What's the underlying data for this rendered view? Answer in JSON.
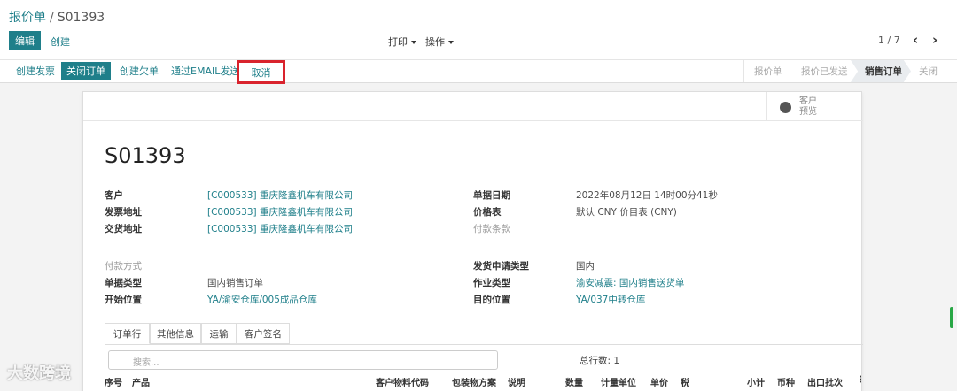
{
  "breadcrumb": {
    "root": "报价单",
    "sep": "/",
    "current": "S01393"
  },
  "toolbar": {
    "edit": "编辑",
    "create": "创建",
    "print": "打印",
    "action": "操作",
    "pager": "1 / 7",
    "prev": "‹",
    "next": "›"
  },
  "actions": {
    "invoice": "创建发票",
    "close_order": "关闭订单",
    "backorder": "创建欠单",
    "email": "通过EMAIL发送",
    "cancel": "取消"
  },
  "stages": [
    "报价单",
    "报价已发送",
    "销售订单",
    "关闭"
  ],
  "preview": {
    "line1": "客户",
    "line2": "预览"
  },
  "doc": {
    "title": "S01393",
    "customer_label": "客户",
    "customer": "[C000533] 重庆隆鑫机车有限公司",
    "invoice_addr_label": "发票地址",
    "invoice_addr": "[C000533] 重庆隆鑫机车有限公司",
    "delivery_addr_label": "交货地址",
    "delivery_addr": "[C000533] 重庆隆鑫机车有限公司",
    "date_label": "单据日期",
    "date": "2022年08月12日 14时00分41秒",
    "pricelist_label": "价格表",
    "pricelist": "默认 CNY 价目表 (CNY)",
    "payterm_label": "付款条款",
    "paymethod_label": "付款方式",
    "doctype_label": "单据类型",
    "doctype": "国内销售订单",
    "start_loc_label": "开始位置",
    "start_loc": "YA/渝安仓库/005成品仓库",
    "ship_req_label": "发货申请类型",
    "ship_req": "国内",
    "op_type_label": "作业类型",
    "op_type": "渝安减震: 国内销售送货单",
    "dest_loc_label": "目的位置",
    "dest_loc": "YA/037中转仓库"
  },
  "tabs": [
    "订单行",
    "其他信息",
    "运输",
    "客户签名"
  ],
  "lines": {
    "search_placeholder": "搜索...",
    "total": "总行数: 1",
    "headers": [
      "序号",
      "产品",
      "客户物料代码",
      "包装物方案",
      "说明",
      "数量",
      "计量单位",
      "单价",
      "税",
      "小计",
      "币种",
      "出口批次",
      "⋮"
    ]
  },
  "watermark": "大数跨境",
  "colors": {
    "accent": "#1f7f8a",
    "highlight": "#d9232d"
  }
}
